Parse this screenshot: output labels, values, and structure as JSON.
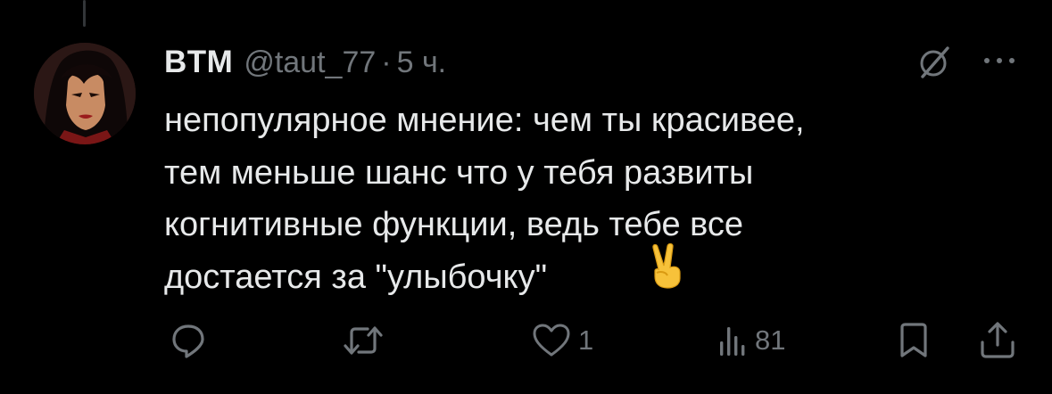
{
  "tweet": {
    "author": {
      "display_name": "BTM",
      "handle": "@taut_77",
      "separator": "·",
      "timestamp": "5 ч.",
      "avatar_icon": "avatar-illustration"
    },
    "text": "непопулярное мнение: чем ты красивее,\nтем меньше шанс что у тебя развиты\nкогнитивные функции, ведь тебе все\nдостается за \"улыбочку\" ",
    "emoji": "victory-hand-emoji",
    "header_icons": [
      "grok-icon",
      "more-icon"
    ],
    "actions": {
      "reply": {
        "icon": "reply-icon",
        "count": ""
      },
      "retweet": {
        "icon": "retweet-icon",
        "count": ""
      },
      "like": {
        "icon": "heart-icon",
        "count": "1"
      },
      "views": {
        "icon": "views-icon",
        "count": "81"
      },
      "bookmark": {
        "icon": "bookmark-icon"
      },
      "share": {
        "icon": "share-icon"
      }
    }
  },
  "colors": {
    "background": "#000000",
    "primary_text": "#e7e9ea",
    "secondary_text": "#71767b",
    "emoji_yellow": "#f7c23a"
  }
}
